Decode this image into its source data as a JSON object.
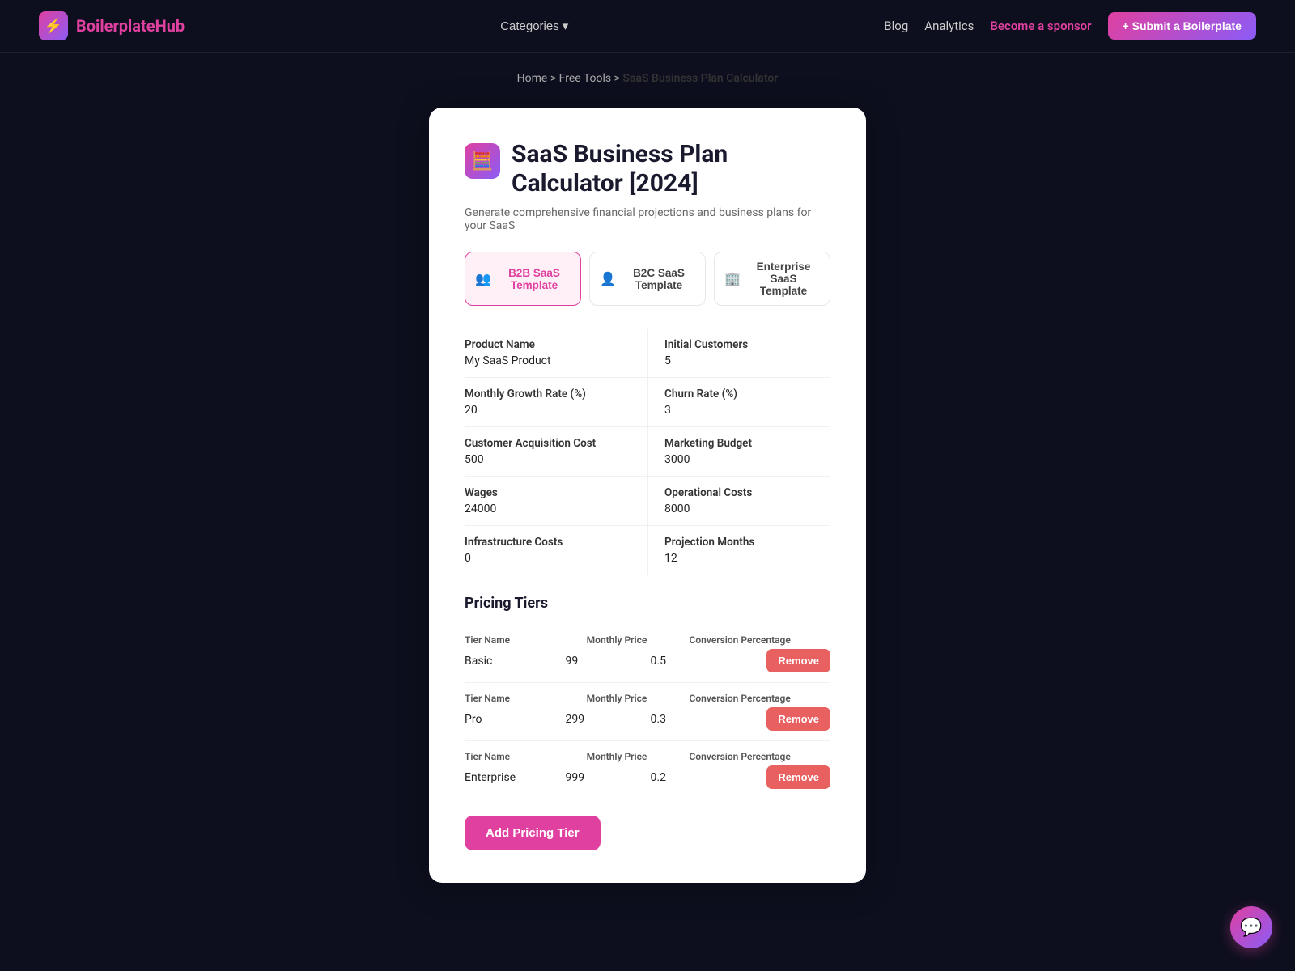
{
  "nav": {
    "logo_text": "BoilerplateHub",
    "categories_label": "Categories",
    "blog_label": "Blog",
    "analytics_label": "Analytics",
    "sponsor_label": "Become a sponsor",
    "submit_label": "+ Submit a Boilerplate"
  },
  "breadcrumb": {
    "home": "Home",
    "sep1": ">",
    "free_tools": "Free Tools",
    "sep2": ">",
    "current": "SaaS Business Plan Calculator"
  },
  "page": {
    "title": "SaaS Business Plan Calculator [2024]",
    "subtitle": "Generate comprehensive financial projections and business plans for your SaaS"
  },
  "templates": [
    {
      "id": "b2b",
      "label": "B2B SaaS Template",
      "icon": "👥",
      "active": true
    },
    {
      "id": "b2c",
      "label": "B2C SaaS Template",
      "icon": "👤",
      "active": false
    },
    {
      "id": "enterprise",
      "label": "Enterprise SaaS Template",
      "icon": "🏢",
      "active": false
    }
  ],
  "fields": [
    {
      "label": "Product Name",
      "value": "My SaaS Product"
    },
    {
      "label": "Initial Customers",
      "value": "5"
    },
    {
      "label": "Monthly Growth Rate (%)",
      "value": "20"
    },
    {
      "label": "Churn Rate (%)",
      "value": "3"
    },
    {
      "label": "Customer Acquisition Cost",
      "value": "500"
    },
    {
      "label": "Marketing Budget",
      "value": "3000"
    },
    {
      "label": "Wages",
      "value": "24000"
    },
    {
      "label": "Operational Costs",
      "value": "8000"
    },
    {
      "label": "Infrastructure Costs",
      "value": "0"
    },
    {
      "label": "Projection Months",
      "value": "12"
    }
  ],
  "pricing_section_title": "Pricing Tiers",
  "tier_columns": {
    "name": "Tier Name",
    "price": "Monthly Price",
    "conversion": "Conversion Percentage"
  },
  "tiers": [
    {
      "name": "Basic",
      "price": "99",
      "conversion": "0.5"
    },
    {
      "name": "Pro",
      "price": "299",
      "conversion": "0.3"
    },
    {
      "name": "Enterprise",
      "price": "999",
      "conversion": "0.2"
    }
  ],
  "remove_label": "Remove",
  "add_tier_label": "Add Pricing Tier"
}
